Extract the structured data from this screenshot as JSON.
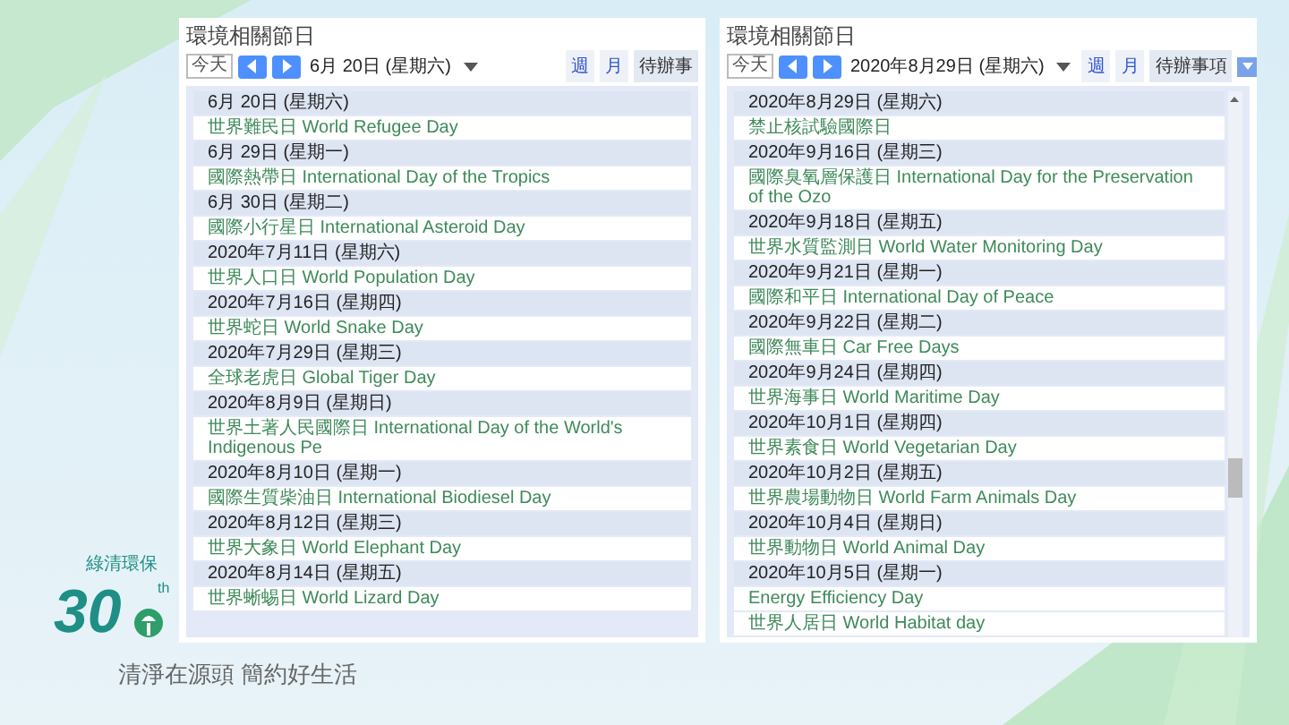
{
  "panels": [
    {
      "title": "環境相關節日",
      "today": "今天",
      "date_label": "6月 20日 (星期六)",
      "views": [
        {
          "label": "週",
          "selected": false
        },
        {
          "label": "月",
          "selected": false
        },
        {
          "label": "待辦事",
          "selected": true
        }
      ],
      "view_menu": false,
      "scrollbar": false,
      "entries": [
        {
          "kind": "date",
          "text": "6月 20日 (星期六)"
        },
        {
          "kind": "event",
          "text": "世界難民日 World Refugee Day"
        },
        {
          "kind": "date",
          "text": "6月 29日 (星期一)"
        },
        {
          "kind": "event",
          "text": "國際熱帶日 International Day of the Tropics"
        },
        {
          "kind": "date",
          "text": "6月 30日 (星期二)"
        },
        {
          "kind": "event",
          "text": "國際小行星日 International Asteroid Day"
        },
        {
          "kind": "date",
          "text": "2020年7月11日 (星期六)"
        },
        {
          "kind": "event",
          "text": "世界人口日 World Population Day"
        },
        {
          "kind": "date",
          "text": "2020年7月16日 (星期四)"
        },
        {
          "kind": "event",
          "text": "世界蛇日 World Snake Day"
        },
        {
          "kind": "date",
          "text": "2020年7月29日 (星期三)"
        },
        {
          "kind": "event",
          "text": "全球老虎日 Global Tiger Day"
        },
        {
          "kind": "date",
          "text": "2020年8月9日 (星期日)"
        },
        {
          "kind": "event",
          "text": "世界土著人民國際日 International Day of the World's Indigenous Pe"
        },
        {
          "kind": "date",
          "text": "2020年8月10日 (星期一)"
        },
        {
          "kind": "event",
          "text": "國際生質柴油日 International Biodiesel Day"
        },
        {
          "kind": "date",
          "text": "2020年8月12日 (星期三)"
        },
        {
          "kind": "event",
          "text": "世界大象日 World Elephant Day"
        },
        {
          "kind": "date",
          "text": "2020年8月14日 (星期五)"
        },
        {
          "kind": "event",
          "text": "世界蜥蜴日 World Lizard Day"
        }
      ]
    },
    {
      "title": "環境相關節日",
      "today": "今天",
      "date_label": "2020年8月29日 (星期六)",
      "views": [
        {
          "label": "週",
          "selected": false
        },
        {
          "label": "月",
          "selected": false
        },
        {
          "label": "待辦事項",
          "selected": true
        }
      ],
      "view_menu": true,
      "scrollbar": true,
      "entries": [
        {
          "kind": "date",
          "text": "2020年8月29日 (星期六)"
        },
        {
          "kind": "event",
          "text": "禁止核試驗國際日"
        },
        {
          "kind": "date",
          "text": "2020年9月16日 (星期三)"
        },
        {
          "kind": "event",
          "text": "國際臭氧層保護日 International Day for the Preservation of the Ozo"
        },
        {
          "kind": "date",
          "text": "2020年9月18日 (星期五)"
        },
        {
          "kind": "event",
          "text": "世界水質監測日 World Water Monitoring Day"
        },
        {
          "kind": "date",
          "text": "2020年9月21日 (星期一)"
        },
        {
          "kind": "event",
          "text": "國際和平日 International Day of Peace"
        },
        {
          "kind": "date",
          "text": "2020年9月22日 (星期二)"
        },
        {
          "kind": "event",
          "text": "國際無車日 Car Free Days"
        },
        {
          "kind": "date",
          "text": "2020年9月24日 (星期四)"
        },
        {
          "kind": "event",
          "text": "世界海事日 World Maritime Day"
        },
        {
          "kind": "date",
          "text": "2020年10月1日 (星期四)"
        },
        {
          "kind": "event",
          "text": "世界素食日 World Vegetarian Day"
        },
        {
          "kind": "date",
          "text": "2020年10月2日 (星期五)"
        },
        {
          "kind": "event",
          "text": "世界農場動物日 World Farm Animals Day"
        },
        {
          "kind": "date",
          "text": "2020年10月4日 (星期日)"
        },
        {
          "kind": "event",
          "text": "世界動物日 World Animal Day"
        },
        {
          "kind": "date",
          "text": "2020年10月5日 (星期一)"
        },
        {
          "kind": "event",
          "text": "Energy Efficiency Day"
        },
        {
          "kind": "event",
          "text": "世界人居日 World Habitat day"
        }
      ]
    }
  ],
  "logo": {
    "number": "30",
    "suffix": "th",
    "label": "綠清環保",
    "slogan": "清淨在源頭 簡約好生活"
  }
}
